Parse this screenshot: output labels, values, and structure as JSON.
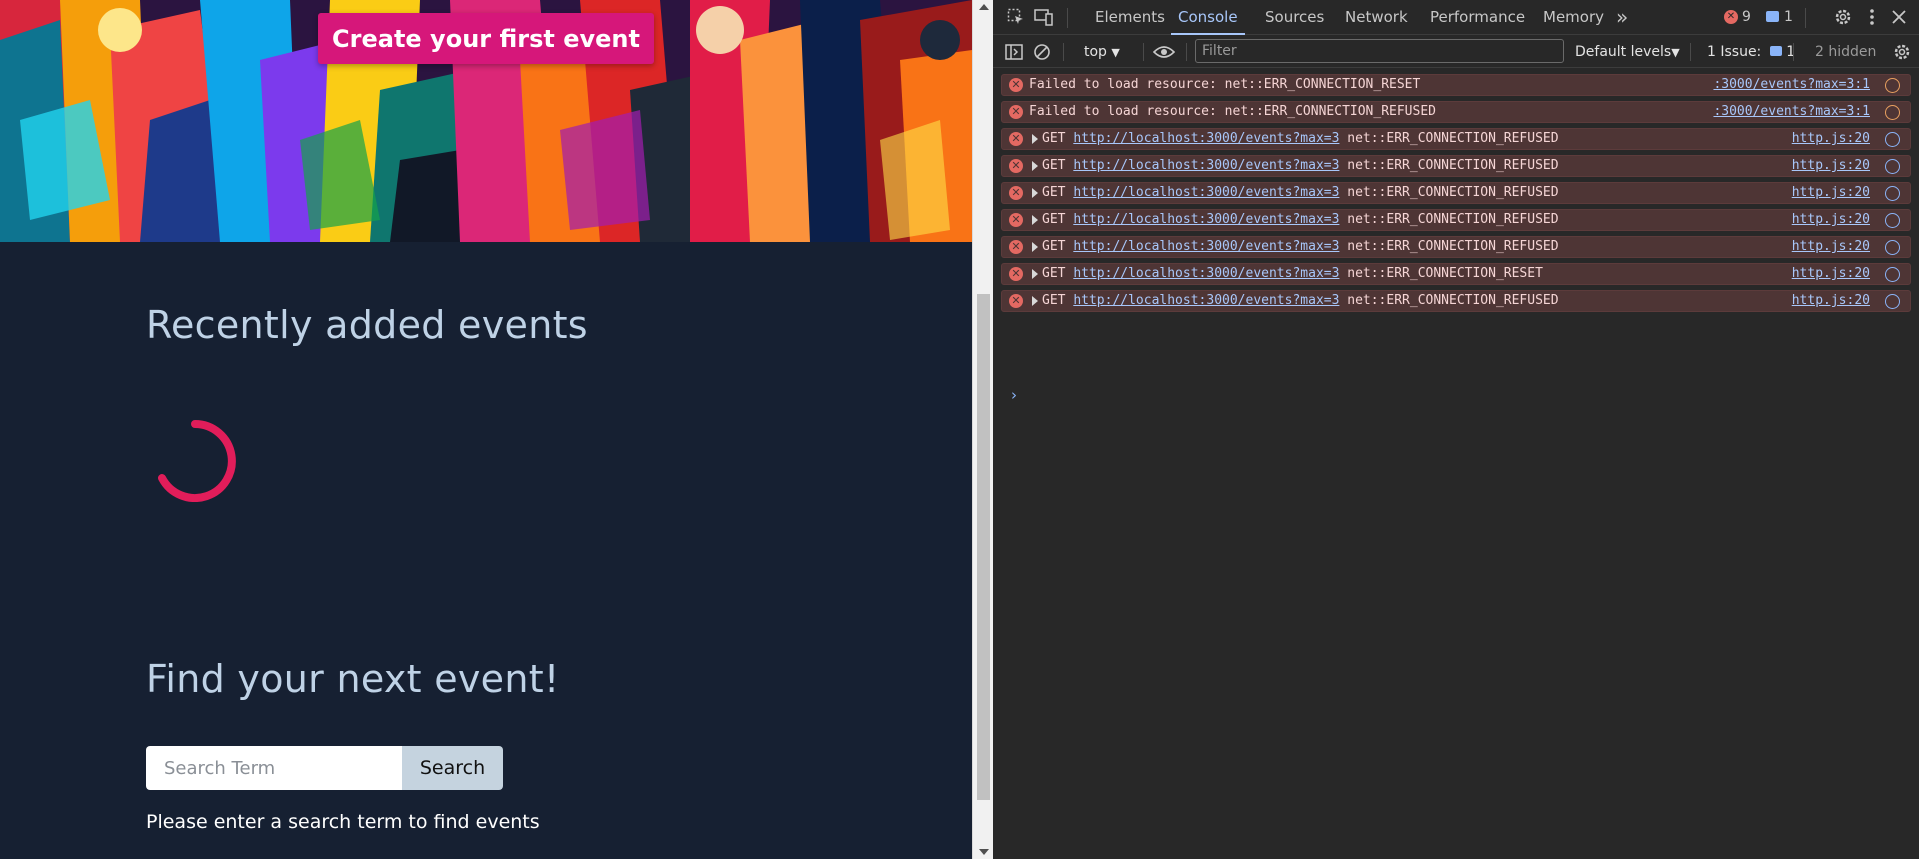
{
  "page": {
    "cta_label": "Create your first event",
    "recent_title": "Recently added events",
    "find_title": "Find your next event!",
    "search_placeholder": "Search Term",
    "search_button": "Search",
    "hint": "Please enter a search term to find events"
  },
  "devtools": {
    "tabs": [
      {
        "label": "Elements",
        "active": false
      },
      {
        "label": "Console",
        "active": true
      },
      {
        "label": "Sources",
        "active": false
      },
      {
        "label": "Network",
        "active": false
      },
      {
        "label": "Performance",
        "active": false
      },
      {
        "label": "Memory",
        "active": false
      }
    ],
    "more_tabs": "»",
    "error_count": "9",
    "message_count": "1",
    "toolbar": {
      "context": "top",
      "filter_placeholder": "Filter",
      "levels": "Default levels",
      "issues_label": "1 Issue:",
      "issues_count": "1",
      "hidden": "2 hidden"
    },
    "rows": [
      {
        "expandable": false,
        "text": "Failed to load resource: net::ERR_CONNECTION_RESET",
        "method": "",
        "url": "",
        "status": "",
        "source": ":3000/events?max=3:1",
        "source_icon": "orange"
      },
      {
        "expandable": false,
        "text": "Failed to load resource: net::ERR_CONNECTION_REFUSED",
        "method": "",
        "url": "",
        "status": "",
        "source": ":3000/events?max=3:1",
        "source_icon": "orange"
      },
      {
        "expandable": true,
        "text": "",
        "method": "GET",
        "url": "http://localhost:3000/events?max=3",
        "status": "net::ERR_CONNECTION_REFUSED",
        "source": "http.js:20",
        "source_icon": "blue"
      },
      {
        "expandable": true,
        "text": "",
        "method": "GET",
        "url": "http://localhost:3000/events?max=3",
        "status": "net::ERR_CONNECTION_REFUSED",
        "source": "http.js:20",
        "source_icon": "blue"
      },
      {
        "expandable": true,
        "text": "",
        "method": "GET",
        "url": "http://localhost:3000/events?max=3",
        "status": "net::ERR_CONNECTION_REFUSED",
        "source": "http.js:20",
        "source_icon": "blue"
      },
      {
        "expandable": true,
        "text": "",
        "method": "GET",
        "url": "http://localhost:3000/events?max=3",
        "status": "net::ERR_CONNECTION_REFUSED",
        "source": "http.js:20",
        "source_icon": "blue"
      },
      {
        "expandable": true,
        "text": "",
        "method": "GET",
        "url": "http://localhost:3000/events?max=3",
        "status": "net::ERR_CONNECTION_REFUSED",
        "source": "http.js:20",
        "source_icon": "blue"
      },
      {
        "expandable": true,
        "text": "",
        "method": "GET",
        "url": "http://localhost:3000/events?max=3",
        "status": "net::ERR_CONNECTION_RESET",
        "source": "http.js:20",
        "source_icon": "blue"
      },
      {
        "expandable": true,
        "text": "",
        "method": "GET",
        "url": "http://localhost:3000/events?max=3",
        "status": "net::ERR_CONNECTION_REFUSED",
        "source": "http.js:20",
        "source_icon": "blue"
      }
    ],
    "prompt_symbol": "›"
  },
  "colors": {
    "accent": "#d6177a",
    "page_bg": "#162032",
    "heading": "#bfd2e6",
    "devtools_bg": "#282828",
    "error_row_bg": "#4e3535",
    "link": "#a8c7fa"
  },
  "icons": [
    "inspect-element-icon",
    "device-toolbar-icon",
    "error-icon",
    "message-icon",
    "gear-icon",
    "more-vertical-icon",
    "close-icon",
    "sidebar-toggle-icon",
    "clear-console-icon",
    "eye-icon",
    "settings-icon",
    "spinner-icon"
  ]
}
